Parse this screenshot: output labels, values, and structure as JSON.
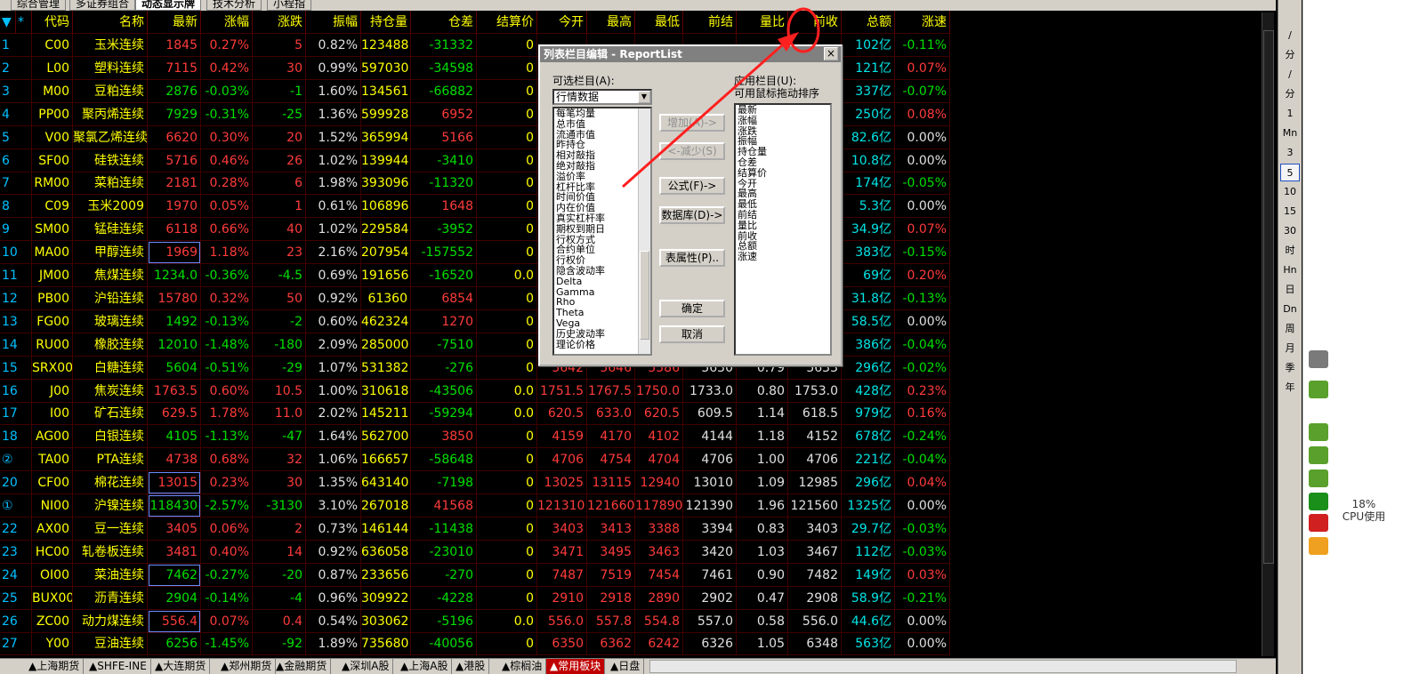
{
  "top_tabs": [
    "综合管理",
    "多证券组合",
    "动态显示牌",
    "技术分析",
    "小程指"
  ],
  "active_top_tab": 2,
  "table": {
    "headers": [
      "▼",
      "*",
      "代码",
      "名称",
      "最新",
      "涨幅",
      "涨跌",
      "振幅",
      "持仓量",
      "仓差",
      "结算价",
      "今开",
      "最高",
      "最低",
      "前结",
      "量比",
      "前收",
      "总额",
      "涨速"
    ],
    "rows": [
      [
        "1",
        "C00",
        "玉米连续",
        "1845",
        "0.27%",
        "5",
        "0.82%",
        "123488",
        "-31332",
        "0",
        "",
        "",
        "",
        "",
        "",
        "",
        "102亿",
        "-0.11%"
      ],
      [
        "2",
        "L00",
        "塑料连续",
        "7115",
        "0.42%",
        "30",
        "0.99%",
        "597030",
        "-34598",
        "0",
        "",
        "",
        "",
        "",
        "",
        "",
        "121亿",
        "0.07%"
      ],
      [
        "3",
        "M00",
        "豆粕连续",
        "2876",
        "-0.03%",
        "-1",
        "1.60%",
        "134561",
        "-66882",
        "0",
        "",
        "",
        "",
        "",
        "",
        "",
        "337亿",
        "-0.07%"
      ],
      [
        "4",
        "PP00",
        "聚丙烯连续",
        "7929",
        "-0.31%",
        "-25",
        "1.36%",
        "599928",
        "6952",
        "0",
        "",
        "",
        "",
        "",
        "",
        "",
        "250亿",
        "0.08%"
      ],
      [
        "5",
        "V00",
        "聚氯乙烯连续",
        "6620",
        "0.30%",
        "20",
        "1.52%",
        "365994",
        "5166",
        "0",
        "",
        "",
        "",
        "",
        "",
        "",
        "82.6亿",
        "0.00%"
      ],
      [
        "6",
        "SF00",
        "硅铁连续",
        "5716",
        "0.46%",
        "26",
        "1.02%",
        "139944",
        "-3410",
        "0",
        "",
        "",
        "",
        "",
        "",
        "",
        "10.8亿",
        "0.00%"
      ],
      [
        "7",
        "RM00",
        "菜粕连续",
        "2181",
        "0.28%",
        "6",
        "1.98%",
        "393096",
        "-11320",
        "0",
        "",
        "",
        "",
        "",
        "",
        "",
        "174亿",
        "-0.05%"
      ],
      [
        "8",
        "C09",
        "玉米2009",
        "1970",
        "0.05%",
        "1",
        "0.61%",
        "106896",
        "1648",
        "0",
        "",
        "",
        "",
        "",
        "",
        "",
        "5.3亿",
        "0.00%"
      ],
      [
        "9",
        "SM00",
        "锰硅连续",
        "6118",
        "0.66%",
        "40",
        "1.02%",
        "229584",
        "-3952",
        "0",
        "",
        "",
        "",
        "",
        "",
        "",
        "34.9亿",
        "0.07%"
      ],
      [
        "10",
        "MA00",
        "甲醇连续",
        "1969",
        "1.18%",
        "23",
        "2.16%",
        "207954",
        "-157552",
        "0",
        "",
        "",
        "",
        "",
        "",
        "",
        "383亿",
        "-0.15%"
      ],
      [
        "11",
        "JM00",
        "焦煤连续",
        "1234.0",
        "-0.36%",
        "-4.5",
        "0.69%",
        "191656",
        "-16520",
        "0.0",
        "",
        "",
        "",
        "",
        "",
        "",
        "69亿",
        "0.20%"
      ],
      [
        "12",
        "PB00",
        "沪铅连续",
        "15780",
        "0.32%",
        "50",
        "0.92%",
        "61360",
        "6854",
        "0",
        "",
        "",
        "",
        "",
        "",
        "",
        "31.8亿",
        "-0.13%"
      ],
      [
        "13",
        "FG00",
        "玻璃连续",
        "1492",
        "-0.13%",
        "-2",
        "0.60%",
        "462324",
        "1270",
        "0",
        "",
        "",
        "",
        "",
        "",
        "",
        "58.5亿",
        "0.00%"
      ],
      [
        "14",
        "RU00",
        "橡胶连续",
        "12010",
        "-1.48%",
        "-180",
        "2.09%",
        "285000",
        "-7510",
        "0",
        "",
        "",
        "",
        "",
        "",
        "",
        "386亿",
        "-0.04%"
      ],
      [
        "15",
        "SRX00",
        "白糖连续",
        "5604",
        "-0.51%",
        "-29",
        "1.07%",
        "531382",
        "-276",
        "0",
        "5642",
        "5646",
        "5586",
        "5630",
        "0.79",
        "5633",
        "296亿",
        "-0.02%"
      ],
      [
        "16",
        "J00",
        "焦炭连续",
        "1763.5",
        "0.60%",
        "10.5",
        "1.00%",
        "310618",
        "-43506",
        "0.0",
        "1751.5",
        "1767.5",
        "1750.0",
        "1733.0",
        "0.80",
        "1753.0",
        "428亿",
        "0.23%"
      ],
      [
        "17",
        "I00",
        "矿石连续",
        "629.5",
        "1.78%",
        "11.0",
        "2.02%",
        "145211",
        "-59294",
        "0.0",
        "620.5",
        "633.0",
        "620.5",
        "609.5",
        "1.14",
        "618.5",
        "979亿",
        "0.16%"
      ],
      [
        "18",
        "AG00",
        "白银连续",
        "4105",
        "-1.13%",
        "-47",
        "1.64%",
        "562700",
        "3850",
        "0",
        "4159",
        "4170",
        "4102",
        "4144",
        "1.18",
        "4152",
        "678亿",
        "-0.24%"
      ],
      [
        "②",
        "TA00",
        "PTA连续",
        "4738",
        "0.68%",
        "32",
        "1.06%",
        "166657",
        "-58648",
        "0",
        "4706",
        "4754",
        "4704",
        "4706",
        "1.00",
        "4706",
        "221亿",
        "-0.04%"
      ],
      [
        "20",
        "CF00",
        "棉花连续",
        "13015",
        "0.23%",
        "30",
        "1.35%",
        "643140",
        "-7198",
        "0",
        "13025",
        "13115",
        "12940",
        "13010",
        "1.09",
        "12985",
        "296亿",
        "0.04%"
      ],
      [
        "①",
        "NI00",
        "沪镍连续",
        "118430",
        "-2.57%",
        "-3130",
        "3.10%",
        "267018",
        "41568",
        "0",
        "121310",
        "121660",
        "117890",
        "121390",
        "1.96",
        "121560",
        "1325亿",
        "0.00%"
      ],
      [
        "22",
        "AX00",
        "豆一连续",
        "3405",
        "0.06%",
        "2",
        "0.73%",
        "146144",
        "-11438",
        "0",
        "3403",
        "3413",
        "3388",
        "3394",
        "0.83",
        "3403",
        "29.7亿",
        "-0.03%"
      ],
      [
        "23",
        "HC00",
        "轧卷板连续",
        "3481",
        "0.40%",
        "14",
        "0.92%",
        "636058",
        "-23010",
        "0",
        "3471",
        "3495",
        "3463",
        "3420",
        "1.03",
        "3467",
        "112亿",
        "-0.03%"
      ],
      [
        "24",
        "OI00",
        "菜油连续",
        "7462",
        "-0.27%",
        "-20",
        "0.87%",
        "233656",
        "-270",
        "0",
        "7487",
        "7519",
        "7454",
        "7461",
        "0.90",
        "7482",
        "149亿",
        "0.03%"
      ],
      [
        "25",
        "BUX00",
        "沥青连续",
        "2904",
        "-0.14%",
        "-4",
        "0.96%",
        "309922",
        "-4228",
        "0",
        "2910",
        "2918",
        "2890",
        "2902",
        "0.47",
        "2908",
        "58.9亿",
        "-0.21%"
      ],
      [
        "26",
        "ZC00",
        "动力煤连续",
        "556.4",
        "0.07%",
        "0.4",
        "0.54%",
        "303062",
        "-5196",
        "0.0",
        "556.0",
        "557.8",
        "554.8",
        "557.0",
        "0.58",
        "556.0",
        "44.6亿",
        "0.00%"
      ],
      [
        "27",
        "Y00",
        "豆油连续",
        "6256",
        "-1.45%",
        "-92",
        "1.89%",
        "735680",
        "-40056",
        "0",
        "6350",
        "6362",
        "6242",
        "6326",
        "1.05",
        "6348",
        "563亿",
        "0.00%"
      ]
    ]
  },
  "dialog": {
    "title": "列表栏目编辑 - ReportList",
    "available_label": "可选栏目(A):",
    "category_value": "行情数据",
    "available_items": [
      "每笔均量",
      "总市值",
      "流通市值",
      "昨持仓",
      "相对敲指",
      "绝对敲指",
      "溢价率",
      "杠杆比率",
      "时间价值",
      "内在价值",
      "真实杠杆率",
      "期权到期日",
      "行权方式",
      "合约单位",
      "行权价",
      "隐含波动率",
      "Delta",
      "Gamma",
      "Rho",
      "Theta",
      "Vega",
      "历史波动率",
      "理论价格"
    ],
    "applied_label": "应用栏目(U):",
    "applied_hint": "可用鼠标拖动排序",
    "applied_items": [
      "最新",
      "涨幅",
      "涨跌",
      "振幅",
      "持仓量",
      "仓差",
      "结算价",
      "今开",
      "最高",
      "最低",
      "前结",
      "量比",
      "前收",
      "总额",
      "涨速"
    ],
    "btn_add": "增加(A)->",
    "btn_remove": "<-减少(S)",
    "btn_formula": "公式(F)->",
    "btn_database": "数据库(D)->",
    "btn_props": "表属性(P)..",
    "btn_ok": "确定",
    "btn_cancel": "取消",
    "close": "×"
  },
  "bottom_tabs": [
    "▲上海期货",
    "▲SHFE-INE",
    "▲大连期货",
    "▲郑州期货",
    "▲金融期货",
    "▲深圳A股",
    "▲上海A股",
    "▲港股",
    "▲棕榈油",
    "▲常用板块",
    "▲日盘"
  ],
  "active_bottom_tab": 9,
  "right_tools": [
    "1m",
    "5m",
    "15m",
    "30m",
    "60m",
    "日",
    "周",
    "月",
    "季",
    "年"
  ],
  "right_tool_labels": [
    "∕",
    "分",
    "∕",
    "分",
    "1",
    "Mn",
    "3",
    "5",
    "10",
    "15",
    "30",
    "时",
    "Hn",
    "日",
    "Dn",
    "周",
    "月",
    "季",
    "年"
  ],
  "cpu": {
    "percent": "18%",
    "label": "CPU使用"
  }
}
